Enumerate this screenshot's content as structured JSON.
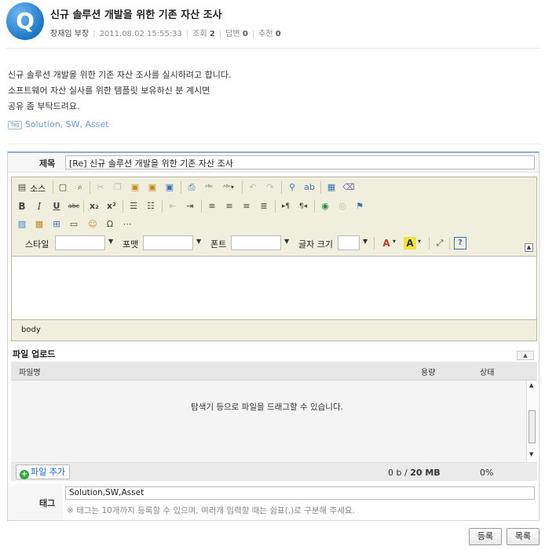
{
  "post": {
    "avatar_letter": "Q",
    "title": "신규 솔루션 개발을 위한 기존 자산 조사",
    "author": "장재임 부장",
    "datetime": "2011.08.02 15:55:33",
    "views_label": "조회",
    "views": "2",
    "replies_label": "답변",
    "replies": "0",
    "recommend_label": "추천",
    "recommend": "0",
    "body_lines": [
      "신규 솔루션 개발을 위한 기존 자산 조사를 실시하려고 합니다.",
      "소프트웨어 자산 실사를 위한 템플릿 보유하신 분 계시면",
      "공유 좀 부탁드려요."
    ],
    "tag_badge": "Tag",
    "tags": [
      "Solution",
      "SW",
      "Asset"
    ],
    "tag_sep": ","
  },
  "form": {
    "title_label": "제목",
    "title_value": "[Re] 신규 솔루션 개발을 위한 기존 자산 조사",
    "editor": {
      "source_label": "소스",
      "style_label": "스타일",
      "format_label": "포맷",
      "font_label": "폰트",
      "size_label": "글자 크기",
      "path_label": "body",
      "collapse_icon": "▲"
    },
    "upload": {
      "label": "파일 업로드",
      "col_name": "파일명",
      "col_size": "용량",
      "col_status": "상태",
      "drop_message": "탐색기 등으로 파일을 드래그할 수 있습니다.",
      "add_button": "파일 추가",
      "used": "0 b",
      "size_sep": "/",
      "limit": "20 MB",
      "percent": "0%"
    },
    "tag_label": "태그",
    "tag_value": "Solution,SW,Asset",
    "tag_help": "※ 태그는 10개까지 등록할 수 있으며, 여러개 입력할 때는 쉼표(,)로 구분해 주세요."
  },
  "buttons": {
    "submit": "등록",
    "list": "목록"
  },
  "colors": {
    "avatar": "#1e78c8",
    "editor_bg": "#f0eedc",
    "tag_link": "#6a9bd8",
    "add_file_icon": "#3aa63a"
  }
}
